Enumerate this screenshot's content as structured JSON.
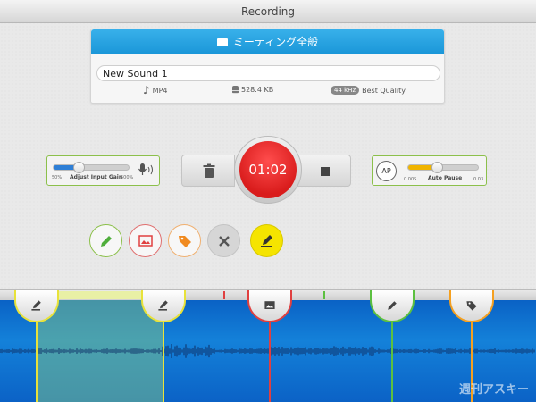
{
  "window": {
    "title": "Recording"
  },
  "recording_card": {
    "title": "ミーティング全般",
    "name_value": "New Sound 1",
    "format": "MP4",
    "size": "528.4 KB",
    "sample_rate": "44 kHz",
    "quality": "Best Quality"
  },
  "input_gain": {
    "label": "Adjust Input Gain",
    "min_label": "50%",
    "max_label": "500%",
    "level_fraction": 0.33,
    "fill_color": "#2e7fd6"
  },
  "recorder": {
    "time": "01:02",
    "record_color": "#e02020"
  },
  "auto_pause": {
    "badge": "AP",
    "label": "Auto Pause",
    "min_label": "0.00S",
    "max_label": "0.03",
    "level_fraction": 0.4,
    "fill_color": "#f0b400"
  },
  "annotation_tools": [
    {
      "name": "pencil",
      "color": "#4fae3c"
    },
    {
      "name": "image",
      "color": "#e04040"
    },
    {
      "name": "tag",
      "color": "#f08a20"
    },
    {
      "name": "close",
      "color": "#666666"
    },
    {
      "name": "highlighter",
      "color": "#f5e400"
    }
  ],
  "markers": [
    {
      "type": "highlighter",
      "color": "#e8e23a"
    },
    {
      "type": "highlighter",
      "color": "#e8e23a"
    },
    {
      "type": "image",
      "color": "#e04040"
    },
    {
      "type": "pencil",
      "color": "#5cc040"
    },
    {
      "type": "tag",
      "color": "#f5a020"
    }
  ],
  "colors": {
    "accent_blue": "#1a96d8",
    "wave_bg": "#0a62c5",
    "panel_border": "#8cc04b"
  },
  "watermark": "週刊アスキー"
}
